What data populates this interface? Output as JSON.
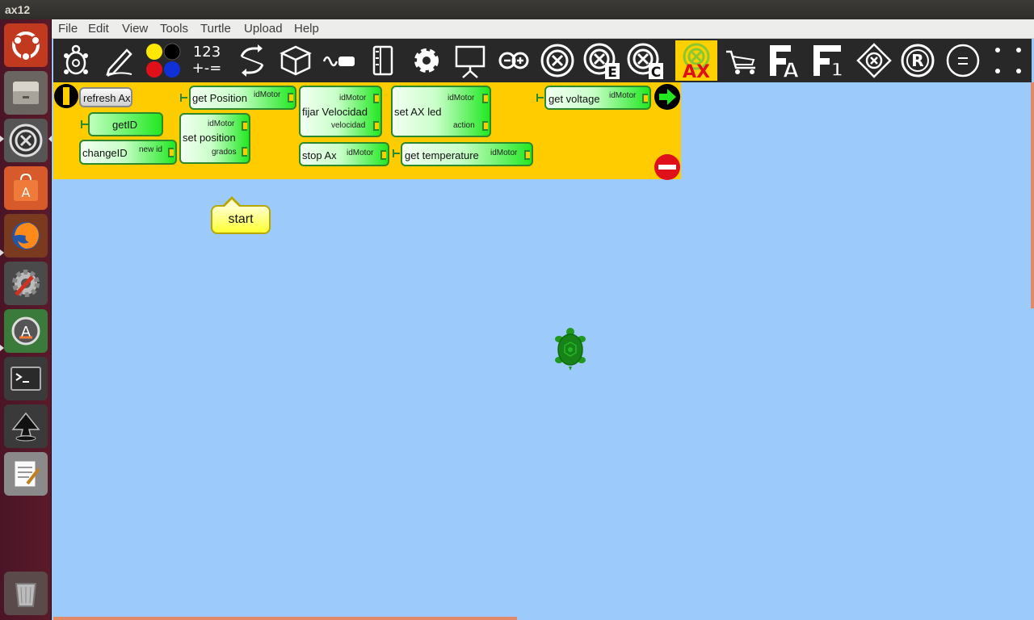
{
  "window": {
    "title": "ax12"
  },
  "menu": {
    "items": [
      "File",
      "Edit",
      "View",
      "Tools",
      "Turtle",
      "Upload",
      "Help"
    ]
  },
  "toolbar": {
    "number_label_top": "123",
    "number_label_bottom": "+-=",
    "ax_label": "AX",
    "e_label": "E",
    "c_label": "C",
    "a_label": "A",
    "one_label": "1",
    "r_label": "R"
  },
  "palette": {
    "refresh_ax": "refresh Ax",
    "get_id": "getID",
    "change_id": "changeID",
    "change_id_arg": "new id",
    "get_position": "get Position",
    "get_position_arg": "idMotor",
    "set_position": "set position",
    "set_position_arg1": "idMotor",
    "set_position_arg2": "grados",
    "fijar_velocidad": "fijar Velocidad",
    "fijar_velocidad_arg1": "idMotor",
    "fijar_velocidad_arg2": "velocidad",
    "stop_ax": "stop Ax",
    "stop_ax_arg": "idMotor",
    "set_ax_led": "set AX led",
    "set_ax_led_arg1": "idMotor",
    "set_ax_led_arg2": "action",
    "get_temperature": "get temperature",
    "get_temperature_arg": "idMotor",
    "get_voltage": "get voltage",
    "get_voltage_arg": "idMotor"
  },
  "canvas": {
    "start_label": "start"
  },
  "colors": {
    "canvas_bg": "#9ccafa",
    "palette_bg": "#ffcc00",
    "toolbar_bg": "#282828",
    "launcher_bg": "#4a1526",
    "turtle": "#1f9a1f"
  },
  "icons": {
    "launcher": [
      "ubuntu-dash-icon",
      "files-icon",
      "ax12-app-icon",
      "software-center-icon",
      "firefox-icon",
      "system-settings-icon",
      "software-updater-icon",
      "terminal-icon",
      "inkscape-icon",
      "text-editor-icon",
      "trash-icon"
    ],
    "toolbar": [
      "turtle-icon",
      "pen-icon",
      "colors-icon",
      "numbers-icon",
      "flow-icon",
      "box-icon",
      "sensors-icon",
      "media-icon",
      "extras-icon",
      "presentation-icon",
      "arduino-icon",
      "ax-plugin-icon",
      "ax-e-icon",
      "ax-c-icon",
      "ax12-icon",
      "cart-icon",
      "fa-icon",
      "f1-icon",
      "diamond-icon",
      "r-icon",
      "minus-icon",
      "more-icon"
    ]
  }
}
